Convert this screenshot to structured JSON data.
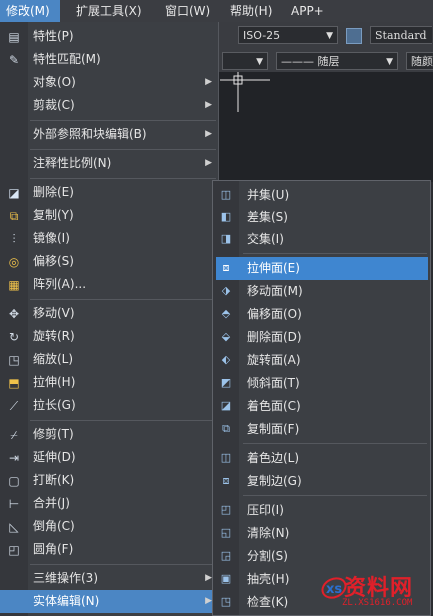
{
  "menubar": {
    "items": [
      {
        "label": "修改(M)",
        "active": true
      },
      {
        "label": "扩展工具(X)"
      },
      {
        "label": "窗口(W)"
      },
      {
        "label": "帮助(H)"
      },
      {
        "label": "APP+"
      }
    ]
  },
  "toolbar": {
    "dimstyle": "ISO-25",
    "textstyle": "Standard",
    "linetype": "——— 随层",
    "lineweight": "随颜"
  },
  "main_menu": {
    "items": [
      {
        "label": "特性(P)",
        "icon": "properties-icon"
      },
      {
        "label": "特性匹配(M)",
        "icon": "match-properties-brush-icon"
      },
      {
        "label": "对象(O)",
        "submenu": true
      },
      {
        "label": "剪裁(C)",
        "submenu": true
      },
      {
        "label": "外部参照和块编辑(B)",
        "submenu": true
      },
      {
        "label": "注释性比例(N)",
        "submenu": true
      },
      {
        "label": "删除(E)",
        "icon": "eraser-icon"
      },
      {
        "label": "复制(Y)",
        "icon": "copy-icon"
      },
      {
        "label": "镜像(I)",
        "icon": "mirror-icon"
      },
      {
        "label": "偏移(S)",
        "icon": "offset-icon"
      },
      {
        "label": "阵列(A)...",
        "icon": "array-icon"
      },
      {
        "label": "移动(V)",
        "icon": "move-icon"
      },
      {
        "label": "旋转(R)",
        "icon": "rotate-icon"
      },
      {
        "label": "缩放(L)",
        "icon": "scale-icon"
      },
      {
        "label": "拉伸(H)",
        "icon": "stretch-icon"
      },
      {
        "label": "拉长(G)",
        "icon": "lengthen-icon"
      },
      {
        "label": "修剪(T)",
        "icon": "trim-icon"
      },
      {
        "label": "延伸(D)",
        "icon": "extend-icon"
      },
      {
        "label": "打断(K)",
        "icon": "break-icon"
      },
      {
        "label": "合并(J)",
        "icon": "join-icon"
      },
      {
        "label": "倒角(C)",
        "icon": "chamfer-icon"
      },
      {
        "label": "圆角(F)",
        "icon": "fillet-icon"
      },
      {
        "label": "三维操作(3)",
        "submenu": true
      },
      {
        "label": "实体编辑(N)",
        "submenu": true,
        "active": true
      }
    ]
  },
  "sub_menu": {
    "items": [
      {
        "label": "并集(U)",
        "icon": "union-icon"
      },
      {
        "label": "差集(S)",
        "icon": "subtract-icon"
      },
      {
        "label": "交集(I)",
        "icon": "intersect-icon"
      },
      {
        "label": "拉伸面(E)",
        "icon": "extrude-face-icon",
        "active": true
      },
      {
        "label": "移动面(M)",
        "icon": "move-face-icon"
      },
      {
        "label": "偏移面(O)",
        "icon": "offset-face-icon"
      },
      {
        "label": "删除面(D)",
        "icon": "delete-face-icon"
      },
      {
        "label": "旋转面(A)",
        "icon": "rotate-face-icon"
      },
      {
        "label": "倾斜面(T)",
        "icon": "taper-face-icon"
      },
      {
        "label": "着色面(C)",
        "icon": "color-face-icon"
      },
      {
        "label": "复制面(F)",
        "icon": "copy-face-icon"
      },
      {
        "label": "着色边(L)",
        "icon": "color-edge-icon"
      },
      {
        "label": "复制边(G)",
        "icon": "copy-edge-icon"
      },
      {
        "label": "压印(I)",
        "icon": "imprint-icon"
      },
      {
        "label": "清除(N)",
        "icon": "clean-icon"
      },
      {
        "label": "分割(S)",
        "icon": "separate-icon"
      },
      {
        "label": "抽壳(H)",
        "icon": "shell-icon"
      },
      {
        "label": "检查(K)",
        "icon": "check-icon"
      }
    ]
  },
  "watermark": {
    "title": "资料网",
    "url": "ZL.XS1616.COM"
  },
  "colors": {
    "menu_bg": "#3c3f44",
    "highlight": "#4b86c4",
    "watermark_red": "#e0202a"
  }
}
